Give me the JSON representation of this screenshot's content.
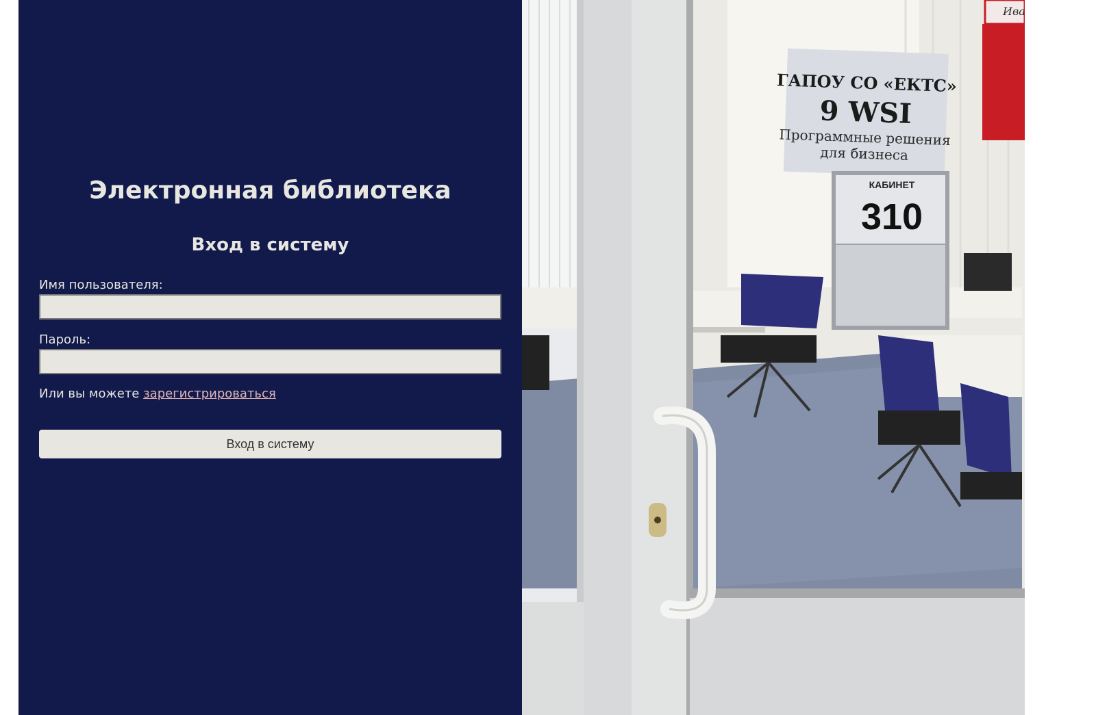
{
  "app": {
    "title": "Электронная библиотека"
  },
  "login": {
    "heading": "Вход в систему",
    "username_label": "Имя пользователя:",
    "username_value": "",
    "password_label": "Пароль:",
    "password_value": "",
    "register_prefix": "Или вы можете",
    "register_link": "зарегистрироваться",
    "submit_label": "Вход в систему"
  },
  "photo": {
    "sign_line1": "ГАПОУ СО «ЕКТС»",
    "sign_line2": "9 WSI",
    "sign_line3": "Программные решения",
    "sign_line4": "для бизнеса",
    "room_label": "КАБИНЕТ",
    "room_number": "310",
    "corner_text": "Иван"
  },
  "colors": {
    "panel_bg": "#111a4b",
    "text_light": "#e8e6e1",
    "link": "#e0b4b4",
    "input_bg": "#e8e6e1"
  }
}
